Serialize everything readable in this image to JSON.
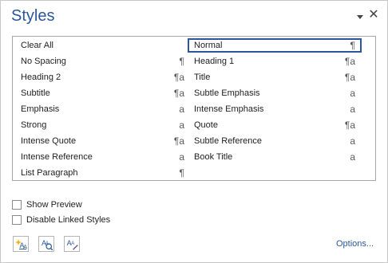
{
  "pane": {
    "title": "Styles",
    "menu_icon": "chevron-down-icon",
    "close_icon": "close-icon",
    "close_glyph": "✕",
    "accent_color": "#2b579a"
  },
  "style_list": {
    "left": [
      {
        "label": "Clear All",
        "type_glyph": ""
      },
      {
        "label": "No Spacing",
        "type_glyph": "¶"
      },
      {
        "label": "Heading 2",
        "type_glyph": "¶a"
      },
      {
        "label": "Subtitle",
        "type_glyph": "¶a"
      },
      {
        "label": "Emphasis",
        "type_glyph": "a"
      },
      {
        "label": "Strong",
        "type_glyph": "a"
      },
      {
        "label": "Intense Quote",
        "type_glyph": "¶a"
      },
      {
        "label": "Intense Reference",
        "type_glyph": "a"
      },
      {
        "label": "List Paragraph",
        "type_glyph": "¶"
      }
    ],
    "right": [
      {
        "label": "Normal",
        "type_glyph": "¶",
        "selected": true
      },
      {
        "label": "Heading 1",
        "type_glyph": "¶a"
      },
      {
        "label": "Title",
        "type_glyph": "¶a"
      },
      {
        "label": "Subtle Emphasis",
        "type_glyph": "a"
      },
      {
        "label": "Intense Emphasis",
        "type_glyph": "a"
      },
      {
        "label": "Quote",
        "type_glyph": "¶a"
      },
      {
        "label": "Subtle Reference",
        "type_glyph": "a"
      },
      {
        "label": "Book Title",
        "type_glyph": "a"
      }
    ]
  },
  "options": {
    "show_preview": {
      "label": "Show Preview",
      "checked": false
    },
    "disable_linked_styles": {
      "label": "Disable Linked Styles",
      "checked": false
    }
  },
  "toolbar": {
    "new_style_icon": "new-style-icon",
    "style_inspector_icon": "style-inspector-icon",
    "manage_styles_icon": "manage-styles-icon"
  },
  "footer": {
    "options_link": "Options..."
  }
}
